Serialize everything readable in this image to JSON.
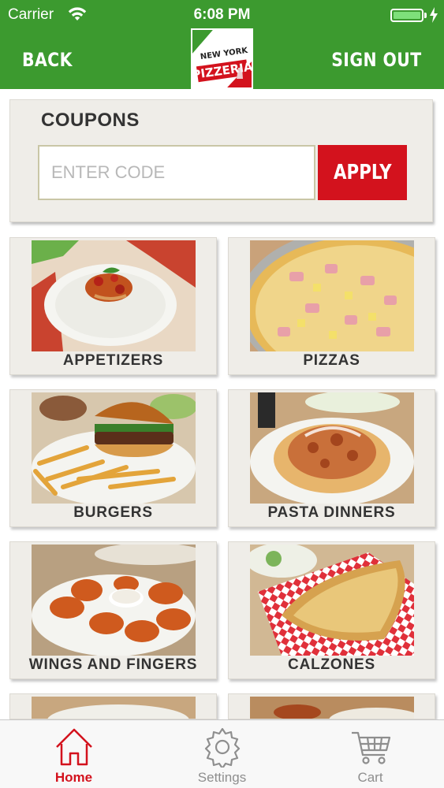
{
  "status": {
    "carrier": "Carrier",
    "time": "6:08 PM"
  },
  "nav": {
    "back_label": "BACK",
    "signout_label": "SIGN OUT",
    "logo_text_top": "NEW YORK",
    "logo_text_main": "PIZZERIA"
  },
  "coupons": {
    "title": "COUPONS",
    "placeholder": "ENTER CODE",
    "value": "",
    "apply_label": "APPLY"
  },
  "menu": {
    "items": [
      {
        "label": "APPETIZERS",
        "icon": "appetizers-photo"
      },
      {
        "label": "PIZZAS",
        "icon": "pizza-photo"
      },
      {
        "label": "BURGERS",
        "icon": "burger-photo"
      },
      {
        "label": "PASTA DINNERS",
        "icon": "pasta-photo"
      },
      {
        "label": "WINGS AND FINGERS",
        "icon": "wings-photo"
      },
      {
        "label": "CALZONES",
        "icon": "calzone-photo"
      }
    ]
  },
  "tabs": [
    {
      "label": "Home",
      "icon": "home-icon",
      "active": true
    },
    {
      "label": "Settings",
      "icon": "gear-icon",
      "active": false
    },
    {
      "label": "Cart",
      "icon": "cart-icon",
      "active": false
    }
  ],
  "colors": {
    "brand_green": "#3c9a2f",
    "accent_red": "#d3121d",
    "card_bg": "#efede8",
    "tab_inactive": "#8e8e8e"
  }
}
